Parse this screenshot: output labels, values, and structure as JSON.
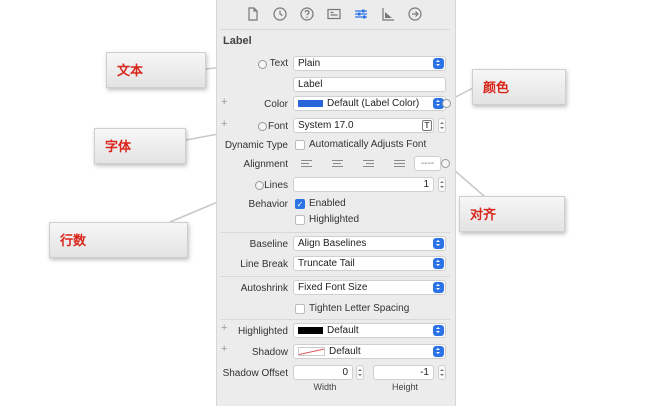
{
  "toolbar": {
    "icons": [
      "file-icon",
      "clock-icon",
      "help-icon",
      "identity-icon",
      "attributes-icon",
      "size-icon",
      "connections-icon"
    ]
  },
  "section_title": "Label",
  "text": {
    "label": "Text",
    "value": "Plain",
    "content": "Label"
  },
  "color": {
    "label": "Color",
    "value": "Default (Label Color)",
    "swatch": "#2b63d9"
  },
  "font": {
    "label": "Font",
    "value": "System 17.0"
  },
  "dynamic_type": {
    "label": "Dynamic Type",
    "checkbox_label": "Automatically Adjusts Font",
    "checked": false
  },
  "alignment": {
    "label": "Alignment",
    "natural": "----"
  },
  "lines": {
    "label": "Lines",
    "value": "1"
  },
  "behavior": {
    "label": "Behavior",
    "enabled_label": "Enabled",
    "enabled": true,
    "highlighted_label": "Highlighted",
    "highlighted": false
  },
  "baseline": {
    "label": "Baseline",
    "value": "Align Baselines"
  },
  "line_break": {
    "label": "Line Break",
    "value": "Truncate Tail"
  },
  "autoshrink": {
    "label": "Autoshrink",
    "value": "Fixed Font Size",
    "tighten_label": "Tighten Letter Spacing",
    "tighten": false
  },
  "highlighted": {
    "label": "Highlighted",
    "value": "Default",
    "swatch": "#000000"
  },
  "shadow": {
    "label": "Shadow",
    "value": "Default"
  },
  "shadow_offset": {
    "label": "Shadow Offset",
    "width_value": "0",
    "height_value": "-1",
    "width_label": "Width",
    "height_label": "Height"
  },
  "callouts": {
    "text": "文本",
    "font": "字体",
    "lines": "行数",
    "color": "颜色",
    "align": "对齐"
  },
  "colors": {
    "accent": "#2b73e6",
    "callout_text": "#d9261c"
  }
}
